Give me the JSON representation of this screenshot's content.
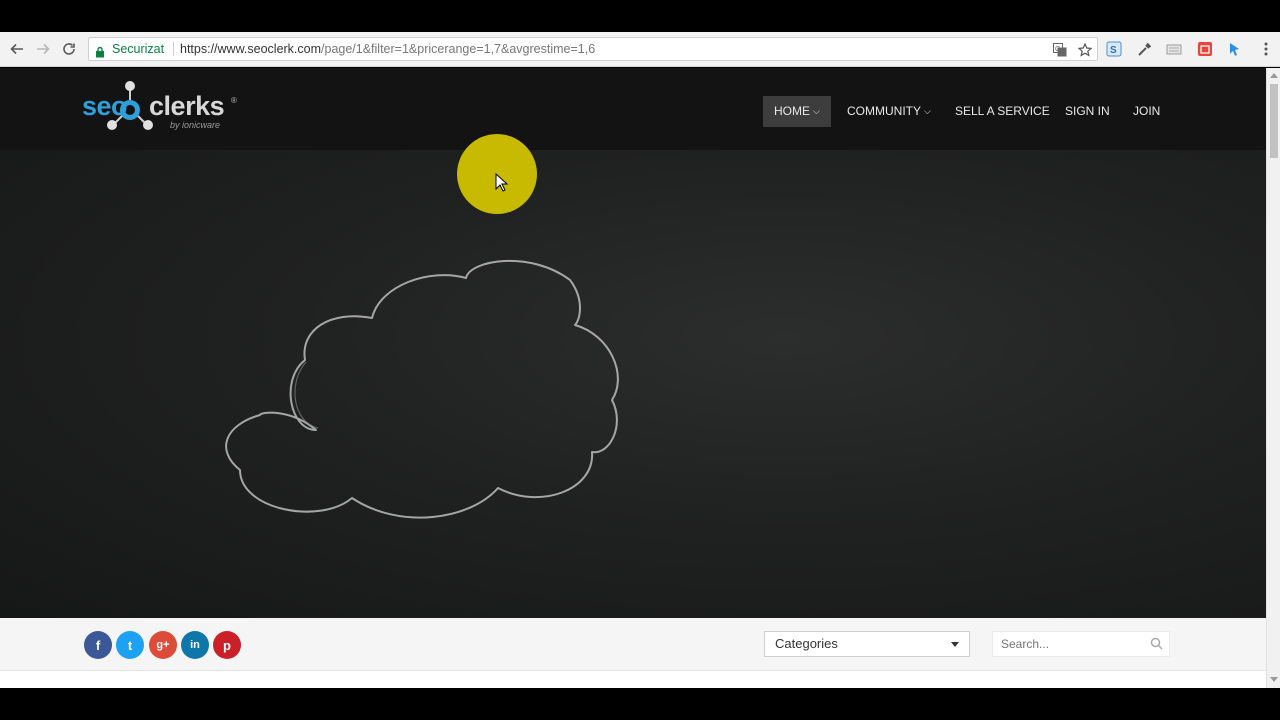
{
  "browser": {
    "secure_label": "Securizat",
    "url_host": "https://www.seoclerk.com",
    "url_path": "/page/1&filter=1&pricerange=1,7&avgrestime=1,6",
    "icons": [
      "back-icon",
      "forward-icon",
      "reload-icon",
      "lock-icon",
      "translate-icon",
      "star-icon",
      "extension-icon",
      "eyedropper-icon",
      "extension-icon",
      "extension-icon",
      "extension-icon",
      "menu-icon"
    ]
  },
  "site": {
    "logo": {
      "seo": "seo",
      "clerks": "clerks",
      "registered": "®",
      "byline": "by ionicware"
    },
    "nav": [
      {
        "label": "HOME",
        "has_dropdown": true,
        "active": true
      },
      {
        "label": "COMMUNITY",
        "has_dropdown": true
      },
      {
        "label": "SELL A SERVICE"
      },
      {
        "label": "SIGN IN"
      },
      {
        "label": "JOIN"
      }
    ]
  },
  "subbar": {
    "social": [
      {
        "name": "facebook",
        "glyph": "f",
        "color": "#3b5998"
      },
      {
        "name": "twitter",
        "glyph": "t",
        "color": "#1da1f2"
      },
      {
        "name": "google-plus",
        "glyph": "g+",
        "color": "#dd4b39"
      },
      {
        "name": "linkedin",
        "glyph": "in",
        "color": "#0e76a8"
      },
      {
        "name": "pinterest",
        "glyph": "p",
        "color": "#cb2027"
      }
    ],
    "categories_label": "Categories",
    "search_placeholder": "Search..."
  },
  "colors": {
    "header_bg": "#131313",
    "hero_bg": "#222323",
    "cursor_highlight": "#d2c200",
    "secure_green": "#0b8043"
  }
}
